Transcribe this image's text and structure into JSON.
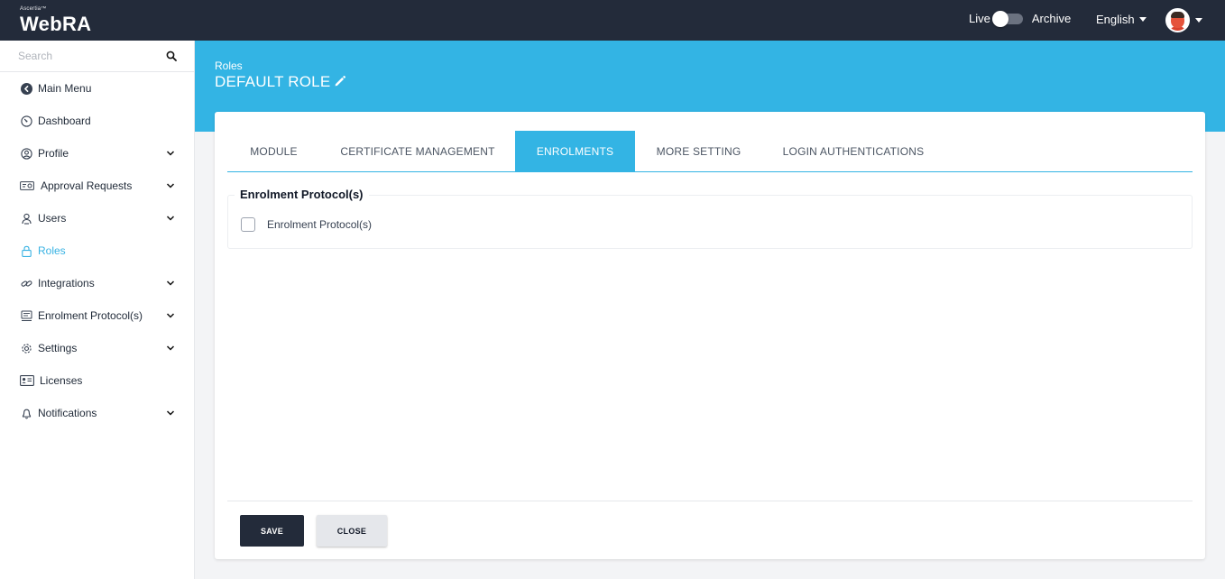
{
  "topbar": {
    "logo_small": "Ascertia™",
    "logo_main": "WebRA",
    "live_label": "Live",
    "archive_label": "Archive",
    "language": "English"
  },
  "sidebar": {
    "search_placeholder": "Search",
    "items": [
      {
        "label": "Main Menu",
        "icon": "back-circle-icon"
      },
      {
        "label": "Dashboard",
        "icon": "gauge-icon"
      },
      {
        "label": "Profile",
        "icon": "user-circle-icon",
        "expandable": true
      },
      {
        "label": "Approval Requests",
        "icon": "approval-icon",
        "expandable": true
      },
      {
        "label": "Users",
        "icon": "users-icon",
        "expandable": true
      },
      {
        "label": "Roles",
        "icon": "lock-icon",
        "active": true
      },
      {
        "label": "Integrations",
        "icon": "link-icon",
        "expandable": true
      },
      {
        "label": "Enrolment Protocol(s)",
        "icon": "protocol-icon",
        "expandable": true
      },
      {
        "label": "Settings",
        "icon": "gear-icon",
        "expandable": true
      },
      {
        "label": "Licenses",
        "icon": "id-card-icon"
      },
      {
        "label": "Notifications",
        "icon": "bell-icon",
        "expandable": true
      }
    ]
  },
  "banner": {
    "breadcrumb": "Roles",
    "title": "DEFAULT ROLE"
  },
  "tabs": [
    {
      "label": "MODULE"
    },
    {
      "label": "CERTIFICATE MANAGEMENT"
    },
    {
      "label": "ENROLMENTS",
      "active": true
    },
    {
      "label": "MORE SETTING"
    },
    {
      "label": "LOGIN AUTHENTICATIONS"
    }
  ],
  "section": {
    "title": "Enrolment Protocol(s)",
    "checkbox_label": "Enrolment Protocol(s)",
    "checked": false
  },
  "actions": {
    "save_label": "SAVE",
    "close_label": "CLOSE"
  },
  "colors": {
    "topbar": "#232b3a",
    "accent": "#33b4e4"
  }
}
